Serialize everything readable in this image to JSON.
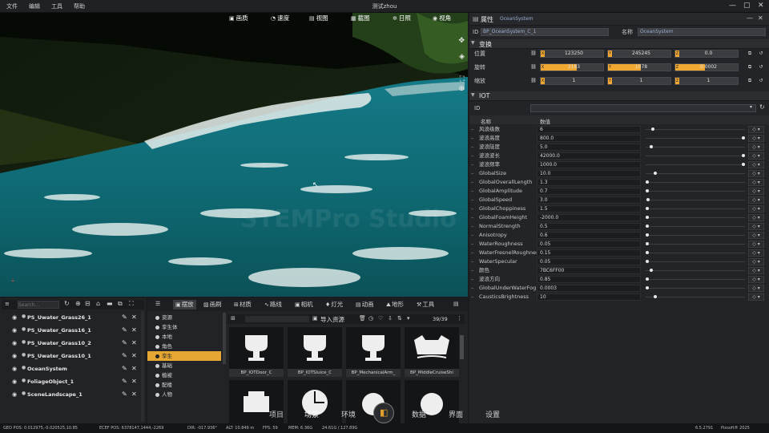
{
  "window": {
    "title": "测试zhou",
    "menu": [
      "文件",
      "编辑",
      "工具",
      "帮助"
    ]
  },
  "viewport": {
    "toolbar": [
      "画质",
      "速度",
      "视图",
      "截图",
      "日照",
      "视角"
    ],
    "watermark": "STEMPro Studio"
  },
  "properties": {
    "header": "属性",
    "object_name": "OceanSystem",
    "id_label": "ID",
    "id_value": "BP_OceanSystem_C_1",
    "name_label": "名称",
    "name_value": "OceanSystem",
    "transform_header": "变换",
    "transform": [
      {
        "label": "位置",
        "x": "123250",
        "y": "245245",
        "z": "0.0",
        "fill": [
          0,
          0,
          0
        ]
      },
      {
        "label": "旋转",
        "x": "2183",
        "y": "1078",
        "z": "0.0002",
        "fill": [
          0.55,
          0.5,
          0.45
        ]
      },
      {
        "label": "缩放",
        "x": "1",
        "y": "1",
        "z": "1",
        "fill": [
          0,
          0,
          0
        ]
      }
    ],
    "iot_header": "IOT",
    "iot_id_label": "ID",
    "table_headers": [
      "名称",
      "数值"
    ],
    "params": [
      {
        "name": "风浪级数",
        "value": "6",
        "knob": 0.06
      },
      {
        "name": "波浪高度",
        "value": "800.0",
        "knob": 0.97
      },
      {
        "name": "波浪陡度",
        "value": "5.0",
        "knob": 0.04
      },
      {
        "name": "波浪波长",
        "value": "42000.0",
        "knob": 0.97
      },
      {
        "name": "波浪频率",
        "value": "1000.0",
        "knob": 0.97
      },
      {
        "name": "GlobalSize",
        "value": "10.0",
        "knob": 0.08
      },
      {
        "name": "GlobalOverallLength",
        "value": "1.3",
        "knob": 0.0
      },
      {
        "name": "GlobalAmplitude",
        "value": "0.7",
        "knob": 0.0
      },
      {
        "name": "GlobalSpeed",
        "value": "3.0",
        "knob": 0.01
      },
      {
        "name": "GlobalChoppiness",
        "value": "1.5",
        "knob": 0.0
      },
      {
        "name": "GlobalFoamHeight",
        "value": "-2000.0",
        "knob": 0.0
      },
      {
        "name": "NormalStrength",
        "value": "0.5",
        "knob": 0.0
      },
      {
        "name": "Anisotropy",
        "value": "0.6",
        "knob": 0.0
      },
      {
        "name": "WaterRoughness",
        "value": "0.05",
        "knob": 0.0
      },
      {
        "name": "WaterFresnelRoughness",
        "value": "0.15",
        "knob": 0.0
      },
      {
        "name": "WaterSpecular",
        "value": "0.05",
        "knob": 0.0
      },
      {
        "name": "颜色",
        "value": "7BC6FF00",
        "knob": 0.04
      },
      {
        "name": "波浪方向",
        "value": "0.85",
        "knob": 0.0
      },
      {
        "name": "GlobalUnderWaterFog",
        "value": "0.0003",
        "knob": 0.0
      },
      {
        "name": "CausticsBrightness",
        "value": "10",
        "knob": 0.08
      }
    ]
  },
  "outliner": {
    "search_placeholder": "Search...",
    "items": [
      "PS_Uwater_Grass26_1",
      "PS_Uwater_Grass16_1",
      "PS_Uwater_Grass10_2",
      "PS_Uwater_Grass10_1",
      "OceanSystem",
      "FoliageObject_1",
      "SceneLandscape_1"
    ]
  },
  "assets": {
    "tabs": [
      "摆放",
      "画刷",
      "材质",
      "路线",
      "相机",
      "灯光",
      "动画",
      "地形",
      "工具"
    ],
    "import_label": "导入资源",
    "count": "39/39",
    "tree": [
      "资源",
      "孪生体",
      "本地",
      "角色",
      "孪生",
      "基础",
      "植被",
      "配楼",
      "人物"
    ],
    "tree_selected_index": 4,
    "cards": [
      "BP_IOTDoor_C",
      "BP_IOTSluice_C",
      "BP_MechanicalArm_",
      "BP_MiddleCruiseShi",
      "",
      "",
      "",
      ""
    ]
  },
  "bottom_nav": {
    "items": [
      "项目",
      "场景",
      "环境",
      "数据",
      "界面",
      "设置"
    ],
    "active": "场景"
  },
  "status": {
    "geo_pos": "GEO POS: 0.012975,-0.020525,10.85",
    "ecef_pos": "ECEF POS: 6378147,1444,-2269",
    "dir": "DIR: -017.936°",
    "alt": "ALT: 10.846 m",
    "fps": "FPS: 59",
    "mem": "MEM: 6.36G",
    "gpu": "24.61G / 127.89G",
    "version": "6.5.2791",
    "copyright": "Pixsoft® 2025"
  }
}
